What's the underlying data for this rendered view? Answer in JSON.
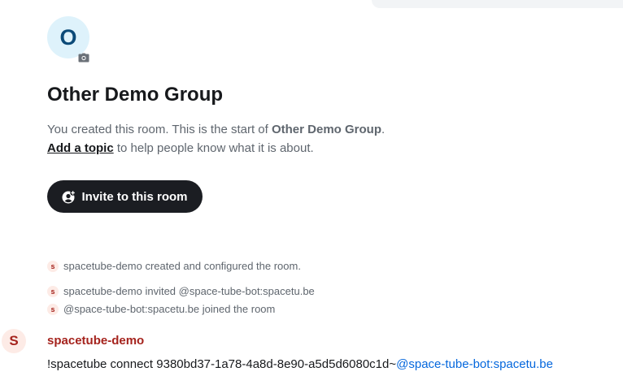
{
  "room": {
    "avatar_letter": "O",
    "name": "Other Demo Group",
    "intro_prefix": "You created this room. This is the start of ",
    "intro_room_name": "Other Demo Group",
    "intro_suffix": ".",
    "add_topic_label": "Add a topic",
    "topic_hint": " to help people know what it is about.",
    "invite_button_label": "Invite to this room"
  },
  "events": [
    {
      "avatar_letter": "s",
      "text": "spacetube-demo created and configured the room."
    },
    {
      "avatar_letter": "s",
      "text": "spacetube-demo invited @space-tube-bot:spacetu.be"
    },
    {
      "avatar_letter": "s",
      "text": "@space-tube-bot:spacetu.be joined the room"
    }
  ],
  "message": {
    "sender_avatar_letter": "S",
    "sender": "spacetube-demo",
    "body_text": "!spacetube connect 9380bd37-1a78-4a8d-8e90-a5d5d6080c1d~",
    "mention": "@space-tube-bot:spacetu.be"
  },
  "colors": {
    "room_avatar_bg": "#def2fb",
    "room_avatar_fg": "#0b4a78",
    "invite_button_bg": "#1b1d22",
    "sender_color": "#a5231d",
    "mention_color": "#0467dd"
  },
  "icons": {
    "camera": "camera-icon",
    "invite": "user-add-icon"
  }
}
